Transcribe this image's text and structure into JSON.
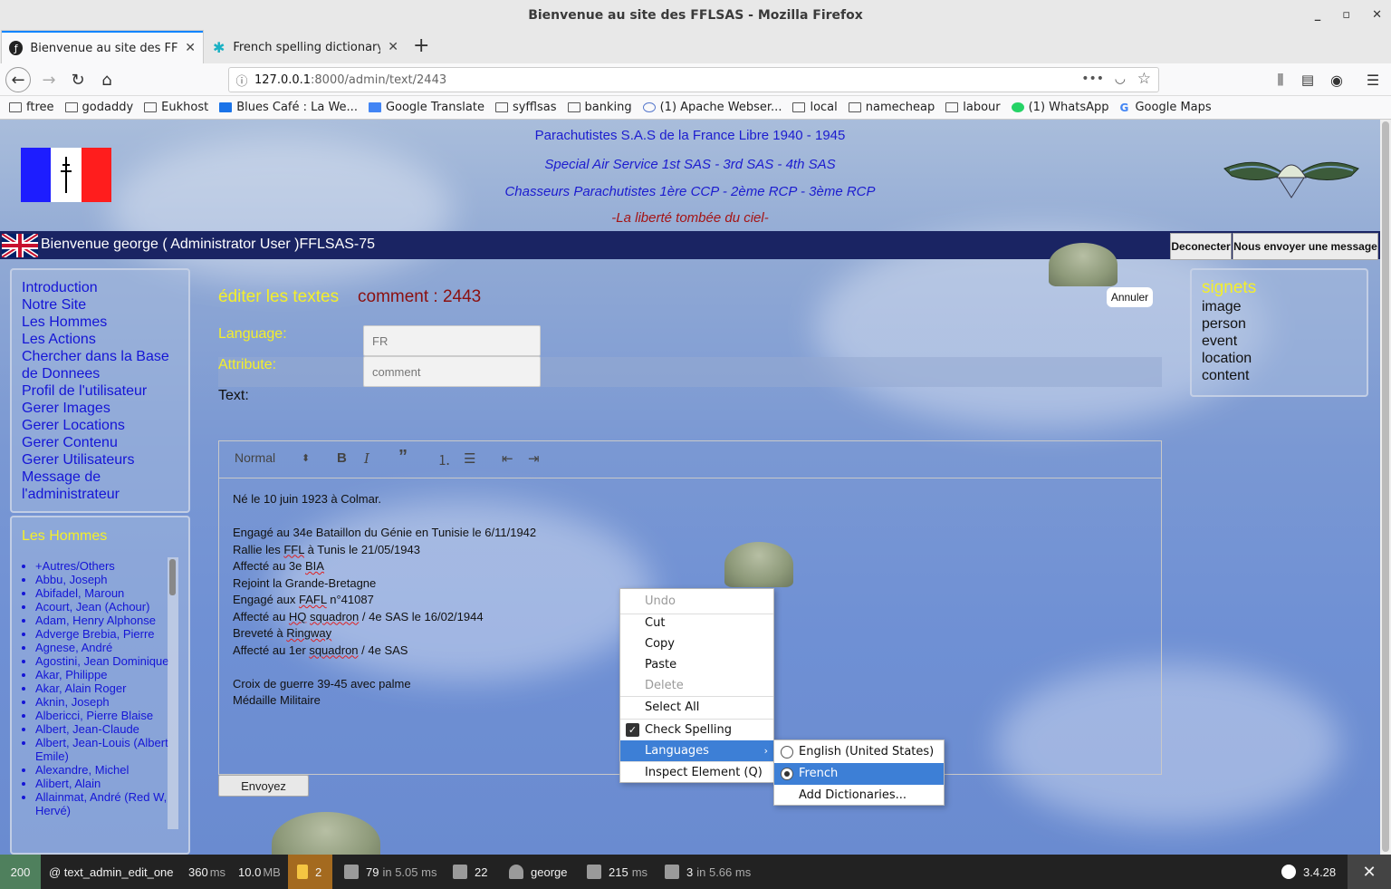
{
  "window": {
    "title": "Bienvenue au site des FFLSAS - Mozilla Firefox",
    "controls": [
      "_",
      "▫",
      "✕"
    ]
  },
  "tabs": [
    {
      "label": "Bienvenue au site des FFLS",
      "icon": "symfony-icon"
    },
    {
      "label": "French spelling dictionary -",
      "icon": "addon-icon"
    }
  ],
  "nav": {
    "url_host": "127.0.0.1",
    "url_rest": ":8000/admin/text/2443"
  },
  "bookmarks": [
    "ftree",
    "godaddy",
    "Eukhost",
    "Blues Café : La We...",
    "Google Translate",
    "syfflsas",
    "banking",
    "(1) Apache Webser...",
    "local",
    "namecheap",
    "labour",
    "(1) WhatsApp",
    "Google Maps"
  ],
  "header": {
    "line1": "Parachutistes S.A.S de la France Libre 1940 - 1945",
    "line2": "Special Air Service 1st SAS - 3rd SAS - 4th SAS",
    "line3": "Chasseurs Parachutistes 1ère CCP - 2ème RCP - 3ème RCP",
    "line4": "-La liberté tombée du ciel-"
  },
  "welcome": {
    "text": "Bienvenue george ( Administrator User )FFLSAS-75",
    "logout": "Deconecter",
    "message": "Nous envoyer une message"
  },
  "leftmenu": [
    "Introduction",
    "Notre Site",
    "Les Hommes",
    "Les Actions",
    "Chercher dans la Base de Donnees",
    "Profil de l'utilisateur",
    "Gerer Images",
    "Gerer Locations",
    "Gerer Contenu",
    "Gerer Utilisateurs",
    "Message de l'administrateur"
  ],
  "hommes": {
    "title": "Les Hommes",
    "items": [
      "+Autres/Others",
      "Abbu, Joseph",
      "Abifadel, Maroun",
      "Acourt, Jean (Achour)",
      "Adam, Henry Alphonse",
      "Adverge Brebia, Pierre",
      "Agnese, André",
      "Agostini, Jean Dominique",
      "Akar, Philippe",
      "Akar, Alain Roger",
      "Aknin, Joseph",
      "Albericci, Pierre Blaise",
      "Albert, Jean-Claude",
      "Albert, Jean-Louis (Albert Emile)",
      "Alexandre, Michel",
      "Alibert, Alain",
      "Allainmat, André (Red W, Hervé)"
    ]
  },
  "signets": {
    "title": "signets",
    "items": [
      "image",
      "person",
      "event",
      "location",
      "content"
    ]
  },
  "form": {
    "title": "éditer les textes",
    "comment": "comment : 2443",
    "cancel": "Annuler",
    "language_label": "Language:",
    "language_value": "FR",
    "attribute_label": "Attribute:",
    "attribute_value": "comment",
    "text_label": "Text:",
    "submit": "Envoyez"
  },
  "editor": {
    "format": "Normal",
    "lines": [
      "Né le 10 juin 1923 à Colmar.",
      "",
      "Engagé au 34e Bataillon du Génie en Tunisie le 6/11/1942",
      "Rallie les FFL à Tunis le 21/05/1943",
      "Affecté au 3e BIA",
      "Rejoint la Grande-Bretagne",
      "Engagé aux FAFL n°41087",
      "Affecté au HQ squadron / 4e SAS le 16/02/1944",
      "Breveté à Ringway",
      "Affecté au 1er squadron / 4e SAS",
      "",
      "Croix de guerre 39-45 avec palme",
      "Médaille Militaire"
    ]
  },
  "context_menu": {
    "items": [
      "Undo",
      "Cut",
      "Copy",
      "Paste",
      "Delete",
      "Select All",
      "Check Spelling",
      "Languages",
      "Inspect Element (Q)"
    ],
    "submenu": [
      "English (United States)",
      "French",
      "Add Dictionaries..."
    ]
  },
  "sfbar": {
    "status": "200",
    "route": "@ text_admin_edit_one",
    "time": "360",
    "time_unit": "ms",
    "memory": "10.0",
    "memory_unit": "MB",
    "warnings": "2",
    "queries": "79",
    "queries_unit": "in 5.05 ms",
    "translations": "22",
    "user": "george",
    "render": "215",
    "render_unit": "ms",
    "cache": "3",
    "cache_unit": "in 5.66 ms",
    "version": "3.4.28"
  },
  "colors": {
    "accent": "#3d7fd6",
    "title_yellow": "#f4ef2a",
    "link_blue": "#1515d6",
    "welcome_bar": "#1a2463"
  }
}
